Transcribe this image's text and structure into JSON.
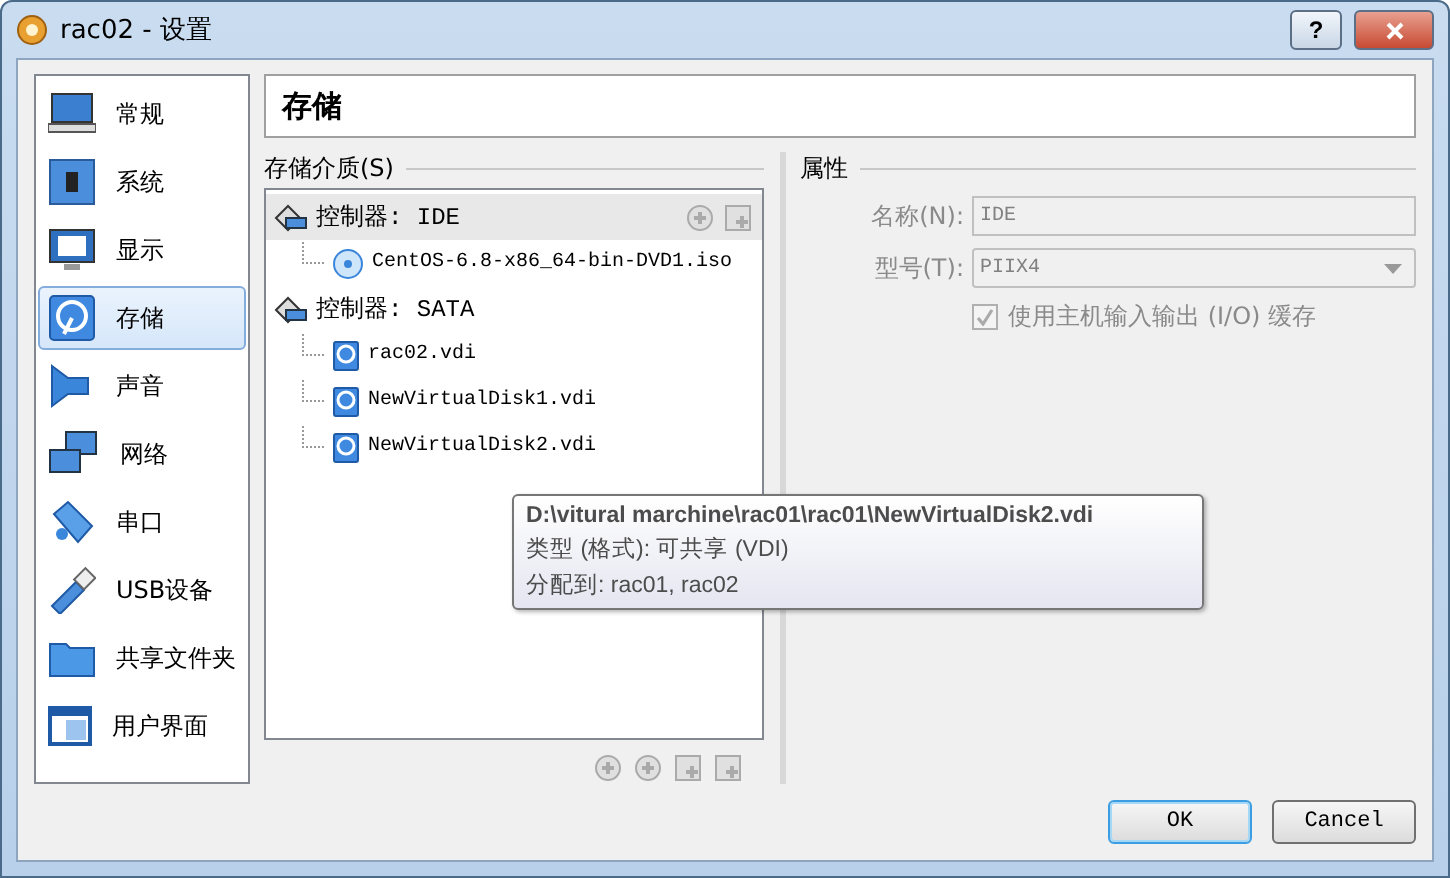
{
  "window": {
    "title": "rac02 - 设置",
    "help_button": "?"
  },
  "sidebar": {
    "items": [
      {
        "label": "常规",
        "selected": false
      },
      {
        "label": "系统",
        "selected": false
      },
      {
        "label": "显示",
        "selected": false
      },
      {
        "label": "存储",
        "selected": true
      },
      {
        "label": "声音",
        "selected": false
      },
      {
        "label": "网络",
        "selected": false
      },
      {
        "label": "串口",
        "selected": false
      },
      {
        "label": "USB设备",
        "selected": false
      },
      {
        "label": "共享文件夹",
        "selected": false
      },
      {
        "label": "用户界面",
        "selected": false
      }
    ]
  },
  "page_title": "存储",
  "storage": {
    "label": "存储介质(S)",
    "tree": [
      {
        "kind": "controller",
        "label": "控制器: IDE",
        "selected": true,
        "children": [
          {
            "kind": "optical",
            "label": "CentOS-6.8-x86_64-bin-DVD1.iso",
            "selected": false
          }
        ]
      },
      {
        "kind": "controller",
        "label": "控制器: SATA",
        "selected": false,
        "children": [
          {
            "kind": "disk",
            "label": "rac02.vdi",
            "selected": false
          },
          {
            "kind": "disk",
            "label": "NewVirtualDisk1.vdi",
            "selected": false
          },
          {
            "kind": "disk",
            "label": "NewVirtualDisk2.vdi",
            "selected": false
          }
        ]
      }
    ]
  },
  "attributes": {
    "label": "属性",
    "name": {
      "label": "名称(N):",
      "value": "IDE",
      "disabled": true
    },
    "type": {
      "label": "型号(T):",
      "value": "PIIX4",
      "disabled": true
    },
    "host_io_cache": {
      "label": "使用主机输入输出 (I/O) 缓存",
      "checked": true,
      "disabled": true
    }
  },
  "tooltip": {
    "path": "D:\\vitural marchine\\rac01\\rac01\\NewVirtualDisk2.vdi",
    "lines": [
      "类型 (格式): 可共享 (VDI)",
      "分配到: rac01, rac02"
    ]
  },
  "buttons": [
    {
      "label": "OK",
      "default": true
    },
    {
      "label": "Cancel",
      "default": false
    }
  ]
}
